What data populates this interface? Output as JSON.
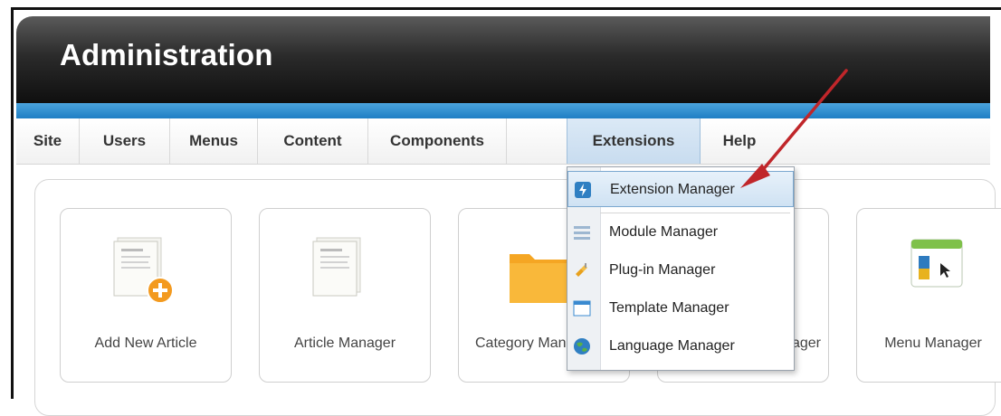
{
  "header": {
    "title": "Administration"
  },
  "menu": {
    "items": [
      "Site",
      "Users",
      "Menus",
      "Content",
      "Components",
      "Extensions",
      "Help"
    ],
    "active": "Extensions"
  },
  "dropdown": {
    "items": [
      {
        "label": "Extension Manager",
        "icon": "extension-icon"
      },
      {
        "label": "Module Manager",
        "icon": "module-icon"
      },
      {
        "label": "Plug-in Manager",
        "icon": "plugin-icon"
      },
      {
        "label": "Template Manager",
        "icon": "template-icon"
      },
      {
        "label": "Language Manager",
        "icon": "globe-icon"
      }
    ]
  },
  "cards": [
    {
      "label": "Add New Article",
      "icon": "add-article-icon"
    },
    {
      "label": "Article Manager",
      "icon": "article-icon"
    },
    {
      "label": "Category Manager",
      "icon": "folder-icon"
    },
    {
      "label": "Media Manager",
      "icon": "media-icon"
    },
    {
      "label": "Menu Manager",
      "icon": "menu-manager-icon"
    }
  ],
  "colors": {
    "accent_blue": "#1f7fc4",
    "arrow": "#c0262a"
  }
}
